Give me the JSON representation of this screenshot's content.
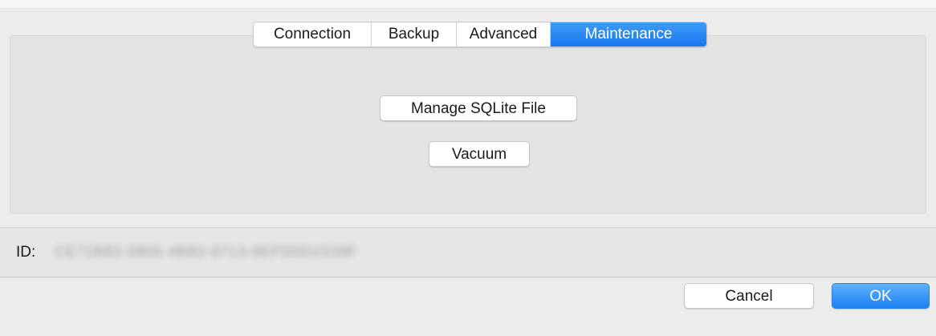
{
  "tabs": {
    "items": [
      {
        "label": "Connection"
      },
      {
        "label": "Backup"
      },
      {
        "label": "Advanced"
      },
      {
        "label": "Maintenance"
      }
    ],
    "selected": "Maintenance"
  },
  "maintenance": {
    "manage_label": "Manage SQLite File",
    "vacuum_label": "Vacuum"
  },
  "id_row": {
    "label": "ID:",
    "value": "CE71B83-0905-4B83-8713-8EFD0D1539F"
  },
  "footer": {
    "cancel_label": "Cancel",
    "ok_label": "OK"
  },
  "colors": {
    "accent": "#1877f0",
    "window_bg": "#ececec"
  }
}
